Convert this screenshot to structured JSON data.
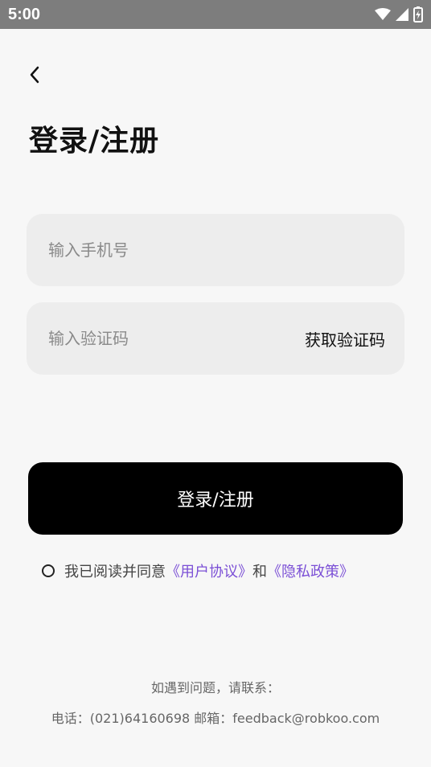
{
  "status_bar": {
    "time": "5:00",
    "icons": [
      "wifi-icon",
      "signal-icon",
      "battery-charging-icon"
    ]
  },
  "header": {
    "back_icon": "chevron-left-icon",
    "title": "登录/注册"
  },
  "form": {
    "phone_placeholder": "输入手机号",
    "phone_value": "",
    "code_placeholder": "输入验证码",
    "code_value": "",
    "get_code_label": "获取验证码",
    "submit_label": "登录/注册"
  },
  "agreement": {
    "checked": false,
    "prefix": "我已阅读并同意",
    "user_agreement": "《用户协议》",
    "conjunction": "和",
    "privacy_policy": "《隐私政策》"
  },
  "footer": {
    "line1": "如遇到问题，请联系：",
    "line2": "电话：(021)64160698 邮箱：feedback@robkoo.com"
  },
  "colors": {
    "status_bar": "#7d7d7d",
    "background": "#f7f7f7",
    "field_bg": "#ededed",
    "button_bg": "#000000",
    "link": "#7b4fd6"
  }
}
